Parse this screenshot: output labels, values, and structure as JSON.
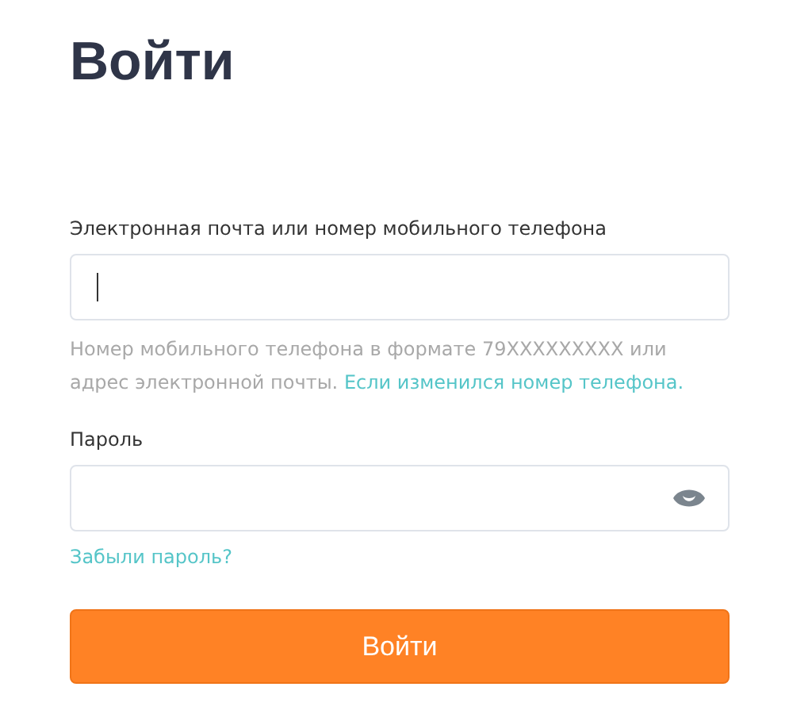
{
  "title": "Войти",
  "login_field": {
    "label": "Электронная почта или номер мобильного телефона",
    "focused": true
  },
  "hint": {
    "text": "Номер мобильного телефона в формате 79XXXXXXXXX или адрес электронной почты.",
    "link": "Если изменился номер телефона."
  },
  "password_field": {
    "label": "Пароль"
  },
  "forgot_link": "Забыли пароль?",
  "submit_button": "Войти"
}
